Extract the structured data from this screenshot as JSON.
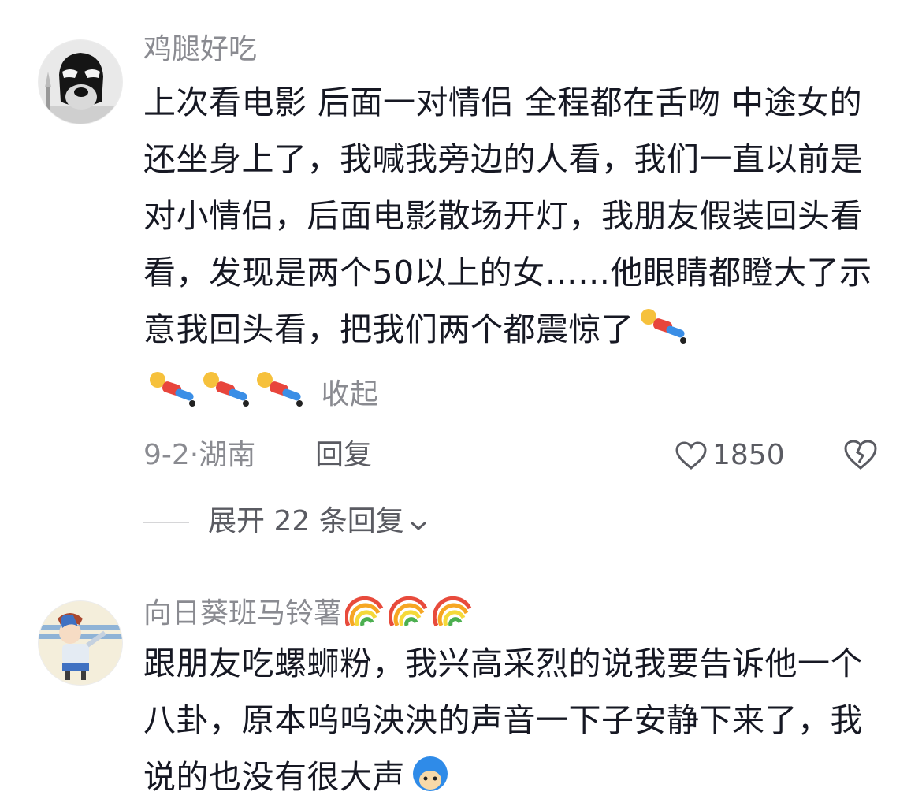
{
  "comment1": {
    "username": "鸡腿好吃",
    "content_text": "上次看电影 后面一对情侣 全程都在舌吻 中途女的还坐身上了，我喊我旁边的人看，我们一直以前是对小情侣，后面电影散场开灯，我朋友假装回头看看，发现是两个50以上的女……他眼睛都瞪大了示意我回头看，把我们两个都震惊了",
    "collapse_label": "收起",
    "date": "9-2·湖南",
    "reply_label": "回复",
    "like_count": "1850",
    "expand_label": "展开 22 条回复",
    "icons": {
      "avatar": "masked-dog-avatar",
      "emoji": "lying-down-doll-emoji",
      "like": "heart-outline-icon",
      "dislike": "broken-heart-icon",
      "expand": "chevron-down-icon"
    }
  },
  "comment2": {
    "username": "向日葵班马铃薯",
    "content_text": "跟朋友吃螺蛳粉，我兴高采烈的说我要告诉他一个八卦，原本呜呜泱泱的声音一下子安静下来了，我说的也没有很大声",
    "icons": {
      "avatar": "cartoon-boy-avatar",
      "username_emoji": "rainbow-emoji",
      "inline_emoji": "blue-hair-face-emoji"
    }
  },
  "colors": {
    "text_primary": "#161823",
    "text_secondary": "#8a8b91",
    "divider": "#d6d6d8"
  }
}
